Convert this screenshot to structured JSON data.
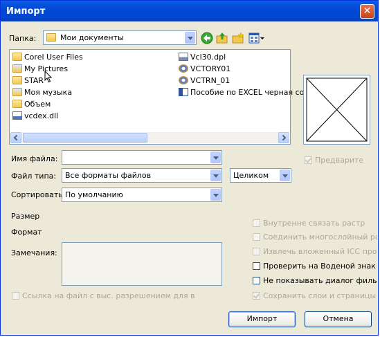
{
  "window": {
    "title": "Импорт",
    "close_glyph": "✕"
  },
  "folder_bar": {
    "label": "Папка:",
    "current": "Мои документы"
  },
  "files": {
    "left": [
      {
        "name": "Corel User Files",
        "icon": "folder-icon"
      },
      {
        "name": "My Pictures",
        "icon": "folder-icon"
      },
      {
        "name": "STAR",
        "icon": "folder-icon"
      },
      {
        "name": "Моя музыка",
        "icon": "folder-icon"
      },
      {
        "name": "Объем",
        "icon": "folder-icon"
      },
      {
        "name": "vcdex.dll",
        "icon": "dll-file-icon"
      }
    ],
    "right": [
      {
        "name": "Vcl30.dpl",
        "icon": "dpl-file-icon"
      },
      {
        "name": "VCTORY01",
        "icon": "media-file-icon"
      },
      {
        "name": "VCTRN_01",
        "icon": "media-file-icon"
      },
      {
        "name": "Пособие по EXCEL черная со",
        "icon": "word-doc-icon"
      }
    ]
  },
  "preview": {
    "label": "Предварите"
  },
  "form": {
    "filename_label": "Имя файла:",
    "filename_value": "",
    "filetype_label": "Файл типа:",
    "filetype_value": "Все форматы файлов",
    "mode_value": "Целиком",
    "sort_label": "Сортировать:",
    "sort_value": "По умолчанию",
    "size_label": "Размер",
    "format_label": "Формат",
    "notes_label": "Замечания:"
  },
  "options": {
    "link_hires": "Ссылка на файл с выс. разрешением для в",
    "link_raster": "Внутренне связать растр",
    "multi_raster": "Соединить многослойный растр",
    "icc_profile": "Извлечь вложенный ICC профа",
    "check_watermark": "Проверить на Воденой знак",
    "no_filter_dialog": "Не показывать диалог фильтра",
    "keep_layers": "Сохранить слои и страницы"
  },
  "buttons": {
    "import": "Импорт",
    "cancel": "Отмена"
  },
  "colors": {
    "titlebar": "#0348d6",
    "dialog_bg": "#ece9d8",
    "close": "#c9431d"
  }
}
